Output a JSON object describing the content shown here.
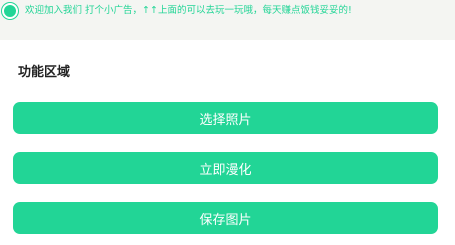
{
  "notice": {
    "icon": "notice-circle-icon",
    "text": "欢迎加入我们 打个小广告，↑↑上面的可以去玩一玩哦，每天赚点饭钱妥妥的!"
  },
  "section": {
    "title": "功能区域"
  },
  "buttons": [
    {
      "label": "选择照片"
    },
    {
      "label": "立即漫化"
    },
    {
      "label": "保存图片"
    }
  ],
  "colors": {
    "accent": "#22d596",
    "background": "#f4f5f2",
    "panel": "#ffffff",
    "title_text": "#222222"
  }
}
